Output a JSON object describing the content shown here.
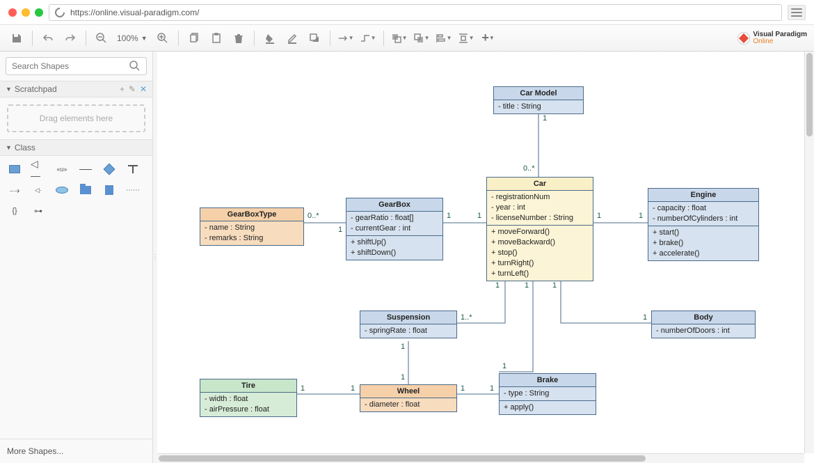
{
  "browser": {
    "url": "https://online.visual-paradigm.com/"
  },
  "toolbar": {
    "zoom": "100%"
  },
  "brand": {
    "line1": "Visual Paradigm",
    "line2": "Online"
  },
  "sidebar": {
    "search_placeholder": "Search Shapes",
    "scratchpad_title": "Scratchpad",
    "drag_hint": "Drag elements here",
    "class_title": "Class",
    "more_shapes": "More Shapes..."
  },
  "classes": {
    "carModel": {
      "name": "Car Model",
      "attrs": [
        "- title : String"
      ]
    },
    "gearBoxType": {
      "name": "GearBoxType",
      "attrs": [
        "- name : String",
        "- remarks : String"
      ]
    },
    "gearBox": {
      "name": "GearBox",
      "attrs": [
        "- gearRatio : float[]",
        "- currentGear : int"
      ],
      "ops": [
        "+ shiftUp()",
        "+ shiftDown()"
      ]
    },
    "car": {
      "name": "Car",
      "attrs": [
        "- registrationNum",
        "- year : int",
        "- licenseNumber : String"
      ],
      "ops": [
        "+ moveForward()",
        "+ moveBackward()",
        "+ stop()",
        "+ turnRight()",
        "+ turnLeft()"
      ]
    },
    "engine": {
      "name": "Engine",
      "attrs": [
        "- capacity : float",
        "- numberOfCylinders : int"
      ],
      "ops": [
        "+ start()",
        "+ brake()",
        "+ accelerate()"
      ]
    },
    "suspension": {
      "name": "Suspension",
      "attrs": [
        "- springRate : float"
      ]
    },
    "body": {
      "name": "Body",
      "attrs": [
        "- numberOfDoors : int"
      ]
    },
    "tire": {
      "name": "Tire",
      "attrs": [
        "- width : float",
        "- airPressure : float"
      ]
    },
    "wheel": {
      "name": "Wheel",
      "attrs": [
        "- diameter : float"
      ]
    },
    "brake": {
      "name": "Brake",
      "attrs": [
        "- type : String"
      ],
      "ops": [
        "+ apply()"
      ]
    }
  },
  "multiplicities": {
    "m1": "1",
    "m0s": "0..*",
    "m1s": "1..*"
  },
  "chart_data": {
    "type": "uml-class-diagram",
    "classes": [
      {
        "name": "Car Model",
        "attributes": [
          "title : String"
        ],
        "operations": []
      },
      {
        "name": "GearBoxType",
        "attributes": [
          "name : String",
          "remarks : String"
        ],
        "operations": []
      },
      {
        "name": "GearBox",
        "attributes": [
          "gearRatio : float[]",
          "currentGear : int"
        ],
        "operations": [
          "shiftUp()",
          "shiftDown()"
        ]
      },
      {
        "name": "Car",
        "attributes": [
          "registrationNum",
          "year : int",
          "licenseNumber : String"
        ],
        "operations": [
          "moveForward()",
          "moveBackward()",
          "stop()",
          "turnRight()",
          "turnLeft()"
        ]
      },
      {
        "name": "Engine",
        "attributes": [
          "capacity : float",
          "numberOfCylinders : int"
        ],
        "operations": [
          "start()",
          "brake()",
          "accelerate()"
        ]
      },
      {
        "name": "Suspension",
        "attributes": [
          "springRate : float"
        ],
        "operations": []
      },
      {
        "name": "Body",
        "attributes": [
          "numberOfDoors : int"
        ],
        "operations": []
      },
      {
        "name": "Tire",
        "attributes": [
          "width : float",
          "airPressure : float"
        ],
        "operations": []
      },
      {
        "name": "Wheel",
        "attributes": [
          "diameter : float"
        ],
        "operations": []
      },
      {
        "name": "Brake",
        "attributes": [
          "type : String"
        ],
        "operations": [
          "apply()"
        ]
      }
    ],
    "associations": [
      {
        "from": "Car Model",
        "to": "Car",
        "from_mult": "1",
        "to_mult": "0..*"
      },
      {
        "from": "GearBoxType",
        "to": "GearBox",
        "from_mult": "1",
        "to_mult": "0..*"
      },
      {
        "from": "GearBox",
        "to": "Car",
        "from_mult": "1",
        "to_mult": "1"
      },
      {
        "from": "Car",
        "to": "Engine",
        "from_mult": "1",
        "to_mult": "1"
      },
      {
        "from": "Car",
        "to": "Suspension",
        "from_mult": "1",
        "to_mult": "1..*"
      },
      {
        "from": "Car",
        "to": "Brake",
        "from_mult": "1",
        "to_mult": "1"
      },
      {
        "from": "Car",
        "to": "Body",
        "from_mult": "1",
        "to_mult": "1"
      },
      {
        "from": "Suspension",
        "to": "Wheel",
        "from_mult": "1",
        "to_mult": "1"
      },
      {
        "from": "Tire",
        "to": "Wheel",
        "from_mult": "1",
        "to_mult": "1"
      },
      {
        "from": "Wheel",
        "to": "Brake",
        "from_mult": "1",
        "to_mult": "1"
      }
    ]
  }
}
